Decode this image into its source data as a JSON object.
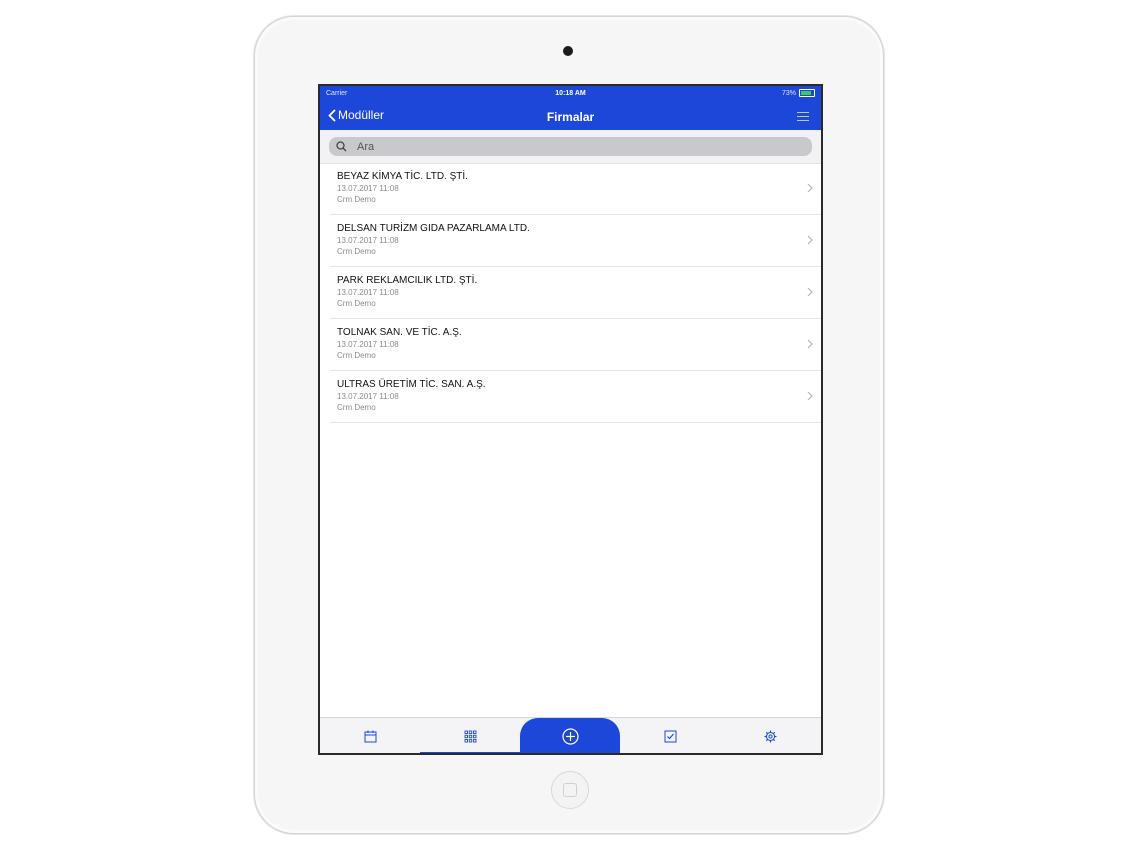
{
  "status": {
    "carrier": "Carrier",
    "time": "10:18 AM",
    "battery": "73%"
  },
  "nav": {
    "back_label": "Modüller",
    "title": "Firmalar"
  },
  "search": {
    "placeholder": "Ara"
  },
  "companies": [
    {
      "name": "BEYAZ KİMYA TİC. LTD. ŞTİ.",
      "date": "13.07.2017 11:08",
      "owner": "Crm Demo"
    },
    {
      "name": "DELSAN TURİZM GIDA PAZARLAMA LTD.",
      "date": "13.07.2017 11:08",
      "owner": "Crm Demo"
    },
    {
      "name": "PARK REKLAMCILIK LTD. ŞTİ.",
      "date": "13.07.2017 11:08",
      "owner": "Crm Demo"
    },
    {
      "name": "TOLNAK SAN. VE TİC. A.Ş.",
      "date": "13.07.2017 11:08",
      "owner": "Crm Demo"
    },
    {
      "name": "ULTRAS ÜRETİM TİC. SAN. A.Ş.",
      "date": "13.07.2017 11:08",
      "owner": "Crm Demo"
    }
  ],
  "tabbar": {
    "tabs": [
      {
        "icon": "calendar-icon"
      },
      {
        "icon": "grid-icon",
        "active": true
      },
      {
        "icon": "plus-circle-icon"
      },
      {
        "icon": "checkbox-icon"
      },
      {
        "icon": "gear-icon"
      }
    ]
  },
  "colors": {
    "accent": "#1d47d8",
    "battery": "#3ad04c"
  }
}
